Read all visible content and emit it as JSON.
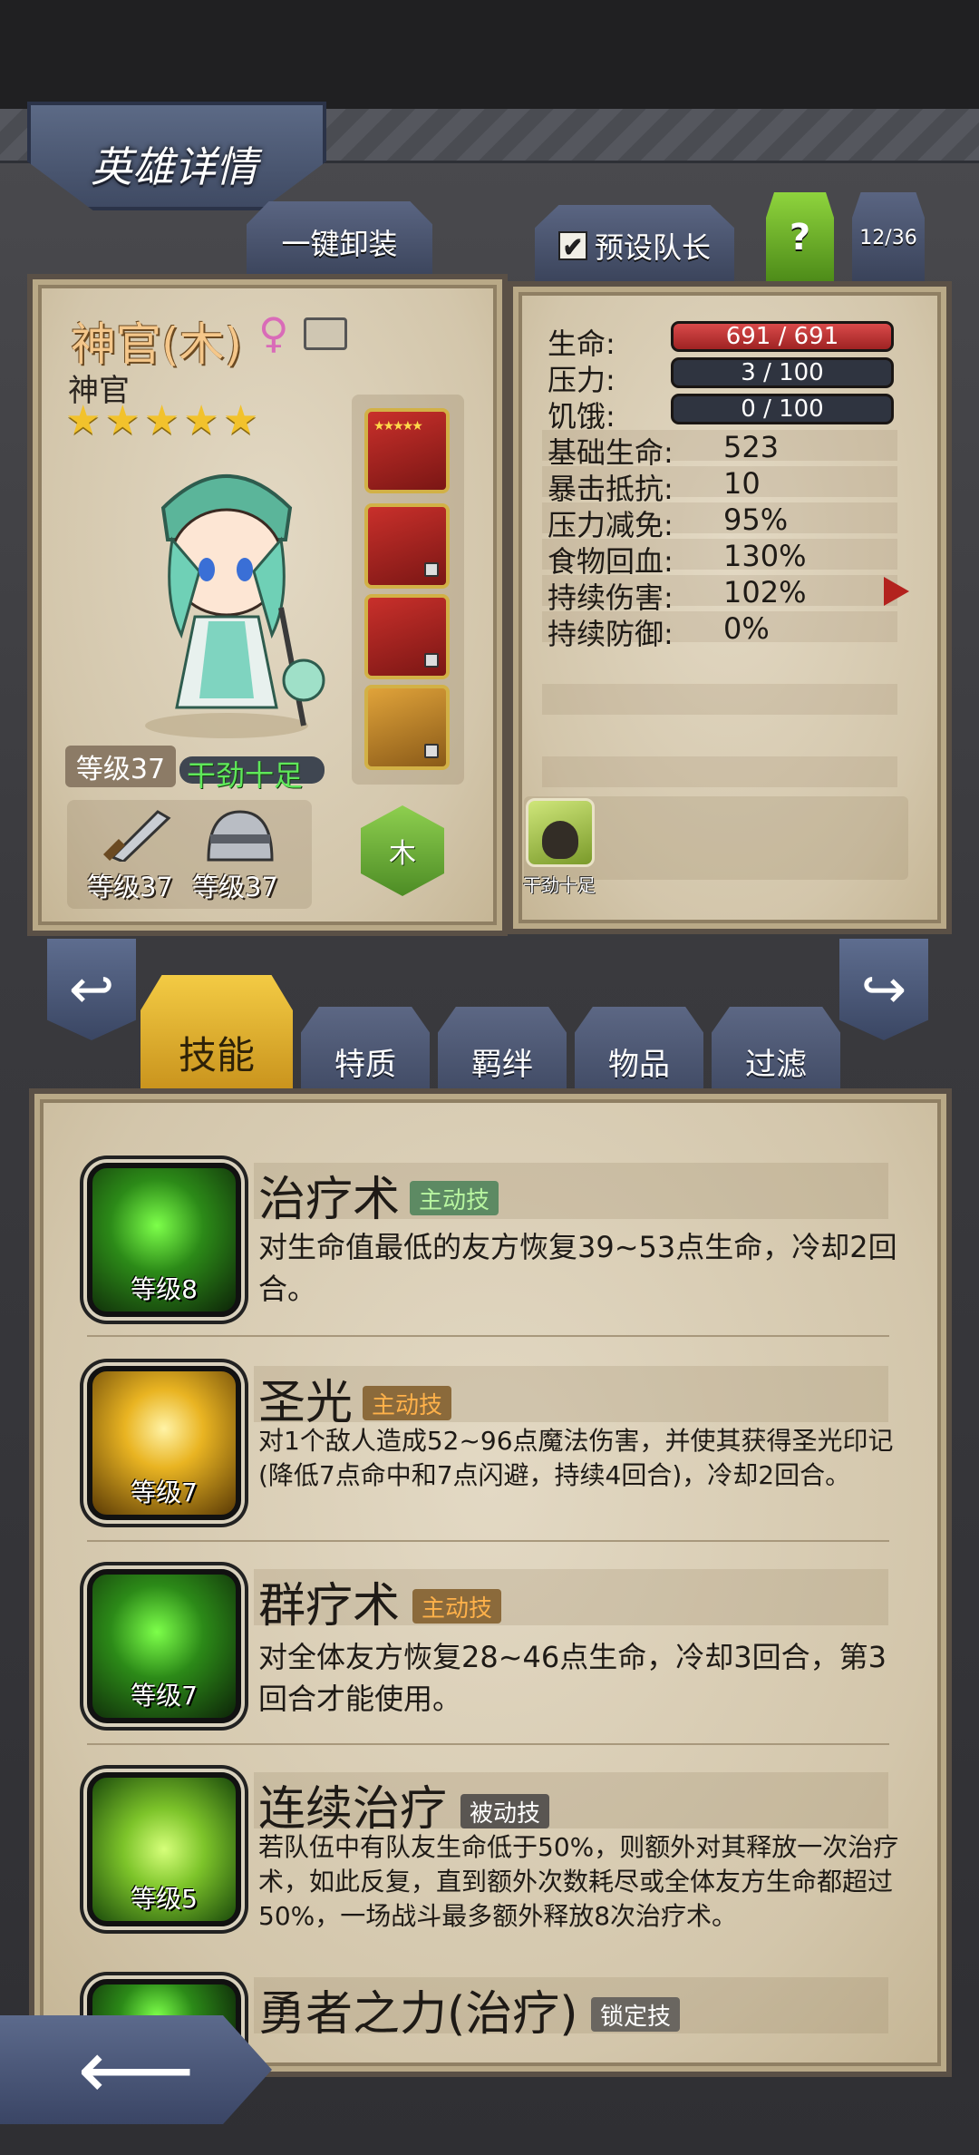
{
  "header": {
    "title": "英雄详情"
  },
  "toolbar": {
    "unequip_label": "一键卸装",
    "preset_leader_label": "预设队长",
    "help_label": "?",
    "hero_count": "12/36"
  },
  "hero": {
    "name": "神官(木)",
    "gender_symbol": "♀",
    "class": "神官",
    "stars": 5,
    "level_label": "等级37",
    "status": "干劲十足",
    "element": "木",
    "weapon_level": "等级37",
    "armor_level": "等级37"
  },
  "stats": {
    "hp_label": "生命:",
    "hp_value": "691 / 691",
    "stress_label": "压力:",
    "stress_value": "3 / 100",
    "hunger_label": "饥饿:",
    "hunger_value": "0 / 100",
    "rows": [
      {
        "label": "基础生命:",
        "value": "523"
      },
      {
        "label": "暴击抵抗:",
        "value": "10"
      },
      {
        "label": "压力减免:",
        "value": "95%"
      },
      {
        "label": "食物回血:",
        "value": "130%"
      },
      {
        "label": "持续伤害:",
        "value": "102%"
      },
      {
        "label": "持续防御:",
        "value": "0%"
      }
    ],
    "buff_label": "干劲十足"
  },
  "tabs": [
    "技能",
    "特质",
    "羁绊",
    "物品",
    "过滤"
  ],
  "skills": [
    {
      "name": "治疗术",
      "tag": "主动技",
      "level": "等级8",
      "desc": "对生命值最低的友方恢复39~53点生命，冷却2回合。"
    },
    {
      "name": "圣光",
      "tag": "主动技",
      "level": "等级7",
      "desc": "对1个敌人造成52~96点魔法伤害，并使其获得圣光印记(降低7点命中和7点闪避，持续4回合)，冷却2回合。"
    },
    {
      "name": "群疗术",
      "tag": "主动技",
      "level": "等级7",
      "desc": "对全体友方恢复28~46点生命，冷却3回合，第3回合才能使用。"
    },
    {
      "name": "连续治疗",
      "tag": "被动技",
      "level": "等级5",
      "desc": "若队伍中有队友生命低于50%，则额外对其释放一次治疗术，如此反复，直到额外次数耗尽或全体友方生命都超过50%，一场战斗最多额外释放8次治疗术。"
    },
    {
      "name": "勇者之力(治疗)",
      "tag": "锁定技"
    }
  ],
  "colors": {
    "accent_gold": "#f3cb44",
    "hp_red": "#d94a4a",
    "panel": "#d8cdb5"
  }
}
